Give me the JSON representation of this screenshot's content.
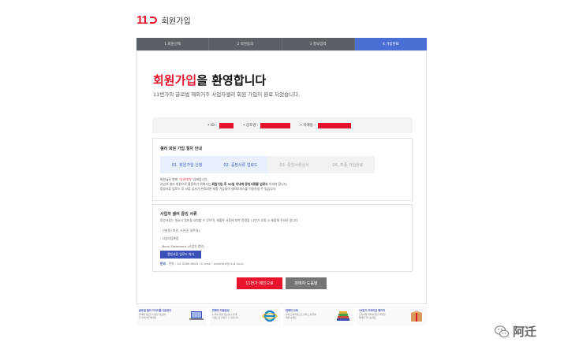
{
  "header": {
    "logo_mark": "11",
    "title": "회원가입"
  },
  "steps": [
    {
      "label": "1 회원선택",
      "active": false
    },
    {
      "label": "2 약관동의",
      "active": false
    },
    {
      "label": "3 정보입력",
      "active": false
    },
    {
      "label": "4 가입완료",
      "active": true
    }
  ],
  "main": {
    "title_highlight": "회원가입",
    "title_rest": "을 환영합니다",
    "subtitle": "11번가의 글로벌 해외거주 사업자셀러 회원 가입이 완료 되었습니다."
  },
  "account_info": {
    "id_label": "• ID :",
    "company_label": "• 상호명 :",
    "email_label": "• 이메일 :"
  },
  "guide": {
    "title": "셀러 회원 가입 절차 안내",
    "flow": [
      {
        "label": "01. 회원가입 신청",
        "done": true
      },
      {
        "label": "02. 증빙서류 업로드",
        "done": true
      },
      {
        "label": "03. 증빙서류심사",
        "done": false
      },
      {
        "label": "04. 최종 가입완료",
        "done": false
      }
    ],
    "status_prefix": "회원님은 현재 ",
    "status_value": "\"승인대기\"",
    "status_suffix": " 상태입니다.",
    "line2_a": "사업자 셀러 회원으로 활동하기 위해서는 ",
    "line2_b": "회원가입 후 90일 이내에 증빙서류를 업로드",
    "line2_c": " 하셔야 합니다.",
    "line3": "증빙서류 업로드 후 서류 심사가 완료되면 최종 가입되어 셀러오피스를 이용하실 수 있습니다."
  },
  "docs": {
    "title": "사업자 셀러 증빙 서류",
    "desc": "증빙서류는 필요시 원본을 요청할 수 있으며, 제출한 서류에 대한 증명을 11번가 요청 시 제출해 주셔야 합니다.",
    "items": [
      "- 신분증 (여권, 시민권, 영주권)",
      "- 사업자등록증",
      "- Bank Statement (사업자 명의)"
    ],
    "upload_label": "증빙서류 업로드 하기",
    "contact_label": "문의",
    "contact_text": "- 전화 : 02-3289-9605 / E-mail : sellerbiz@11st.co.kr"
  },
  "buttons": {
    "main_label": "11번가 메인으로",
    "guide_label": "판매자 도움말"
  },
  "banners": [
    {
      "title": "글로벌 셀러 가이드를 다운로드",
      "desc": "판매에 필요한 다양한 정보를\n한 번에 확인하세요",
      "icon": "laptop-icon",
      "color": "#3a52b8"
    },
    {
      "title": "판매자 자동완성",
      "desc": "e-셀러 맞춤 정보를 손쉽게\n자동으로 완성할 수 있습니다",
      "icon": "ie-browser-icon",
      "color": "#1e88c8"
    },
    {
      "title": "판매자 교육",
      "desc": "셀러 교육과정으로 판매 노하우를\n배워 보세요",
      "icon": "books-icon",
      "color": "#c84a3a"
    },
    {
      "title": "11번가 프리미엄 패키지",
      "desc": "프리미엄 셀러를 위한 특별한\n혜택을 만나보세요",
      "icon": "package-icon",
      "color": "#c87a3a"
    }
  ],
  "watermark": {
    "text": "阿迁",
    "icon": "wechat-icon"
  }
}
